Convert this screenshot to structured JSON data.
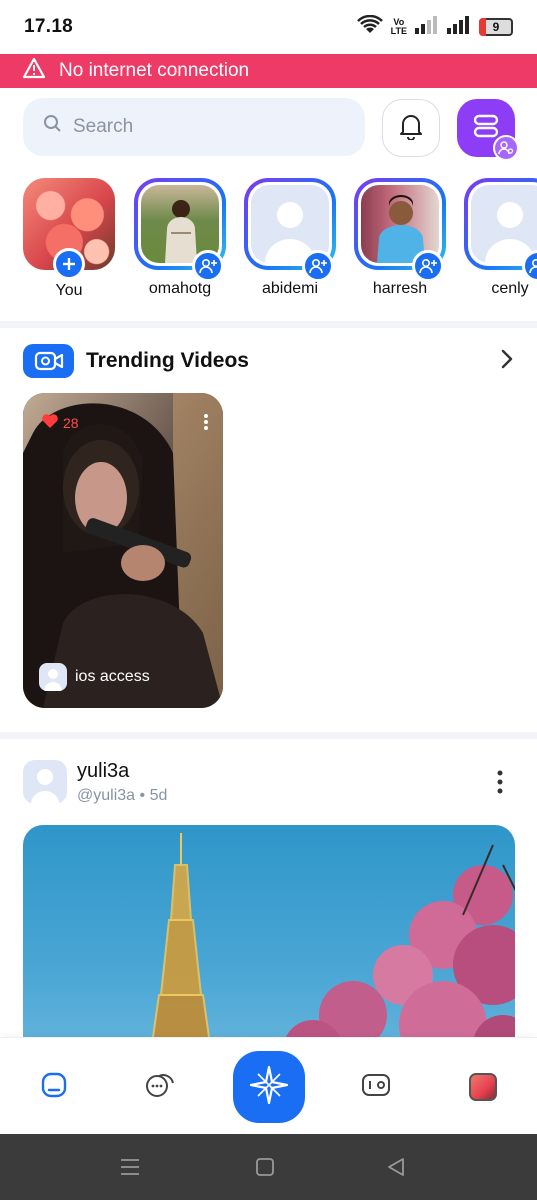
{
  "status_bar": {
    "time": "17.18",
    "network_label_top": "Vo",
    "network_label_bottom": "LTE",
    "battery": "9",
    "icons": [
      "wifi-icon",
      "signal-icon",
      "signal-icon",
      "battery-icon"
    ]
  },
  "offline_banner": {
    "icon": "warning-icon",
    "text": "No internet connection",
    "color": "#ee3a66"
  },
  "header": {
    "search_placeholder": "Search",
    "notifications_icon": "bell-icon",
    "menu_icon": "menu-icon",
    "accent": "#8c3df5"
  },
  "stories": [
    {
      "name": "You",
      "own": true
    },
    {
      "name": "omahotg",
      "own": false
    },
    {
      "name": "abidemi",
      "own": false
    },
    {
      "name": "harresh",
      "own": false
    },
    {
      "name": "cenly",
      "own": false
    }
  ],
  "trending": {
    "title": "Trending Videos",
    "icon": "video-camera-icon",
    "videos": [
      {
        "likes": "28",
        "author": "ios access"
      }
    ]
  },
  "post": {
    "name": "yuli3a",
    "handle": "@yuli3a",
    "dot": "•",
    "age": "5d"
  },
  "bottom_nav": {
    "items": [
      "home-icon",
      "chat-icon",
      "compass-star-icon",
      "wallet-icon",
      "profile-avatar"
    ],
    "accent": "#1a6ef3"
  }
}
